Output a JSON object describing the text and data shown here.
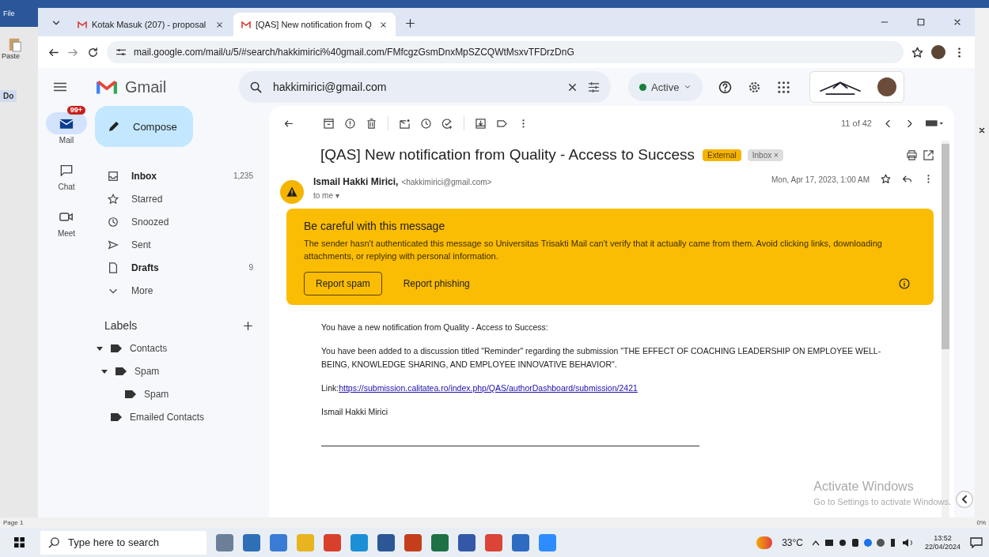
{
  "word": {
    "file_label": "File",
    "paste_label": "Paste",
    "doc_tab": "Do",
    "status": "Page 1",
    "zoom": "0%"
  },
  "browser": {
    "tabs": [
      {
        "title": "Kotak Masuk (207) - proposal",
        "selected": false
      },
      {
        "title": "[QAS] New notification from Q",
        "selected": true
      }
    ],
    "url": "mail.google.com/mail/u/5/#search/hakkimirici%40gmail.com/FMfcgzGsmDnxMpSZCQWtMsxvTFDrzDnG"
  },
  "gmail": {
    "logo": "Gmail",
    "search": {
      "value": "hakkimirici@gmail.com"
    },
    "status": "Active",
    "rail": [
      {
        "label": "Mail",
        "selected": true,
        "badge": "99+"
      },
      {
        "label": "Chat",
        "selected": false
      },
      {
        "label": "Meet",
        "selected": false
      }
    ],
    "compose": "Compose",
    "nav": [
      {
        "label": "Inbox",
        "count": "1,235",
        "unread": true
      },
      {
        "label": "Starred",
        "unread": false
      },
      {
        "label": "Snoozed",
        "unread": false
      },
      {
        "label": "Sent",
        "unread": false
      },
      {
        "label": "Drafts",
        "count": "9",
        "unread": true
      },
      {
        "label": "More",
        "unread": false
      }
    ],
    "labels_heading": "Labels",
    "labels": [
      {
        "name": "Contacts",
        "expanded": true,
        "children": [
          {
            "name": "Spam",
            "expanded": true,
            "children": [
              {
                "name": "Spam"
              }
            ]
          }
        ]
      },
      {
        "name": "Emailed Contacts"
      }
    ]
  },
  "message": {
    "counter": "11 of 42",
    "subject": "[QAS] New notification from Quality - Access to Success",
    "tags": [
      {
        "label": "External",
        "kind": "warning"
      },
      {
        "label": "Inbox ×",
        "kind": "folder"
      }
    ],
    "sender_name": "Ismail Hakki Mirici,",
    "sender_email": "<hakkimirici@gmail.com>",
    "recipient": "to me ▾",
    "date": "Mon, Apr 17, 2023, 1:00 AM",
    "warning": {
      "title": "Be careful with this message",
      "text": "The sender hasn't authenticated this message so Universitas Trisakti Mail can't verify that it actually came from them. Avoid clicking links, downloading attachments, or replying with personal information.",
      "buttons": [
        {
          "label": "Report spam",
          "kind": "outlined"
        },
        {
          "label": "Report phishing",
          "kind": "text"
        }
      ]
    },
    "body": [
      {
        "text": "You have a new notification from Quality - Access to Success:"
      },
      {
        "text": "You have been added to a discussion titled \"Reminder\" regarding the submission \"THE EFFECT OF COACHING LEADERSHIP ON EMPLOYEE WELL-BEING, KNOWLEDGE SHARING, AND EMPLOYEE INNOVATIVE BEHAVIOR\"."
      },
      {
        "text": "Link:",
        "link": "https://submission.calitatea.ro/index.php/QAS/authorDashboard/submission/2421"
      },
      {
        "text": "Ismail Hakki Mirici"
      }
    ]
  },
  "activation": {
    "title": "Activate Windows",
    "subtitle": "Go to Settings to activate Windows."
  },
  "taskbar": {
    "search_placeholder": "Type here to search",
    "weather": "33°C",
    "time": "13:52",
    "date": "22/04/2024"
  }
}
